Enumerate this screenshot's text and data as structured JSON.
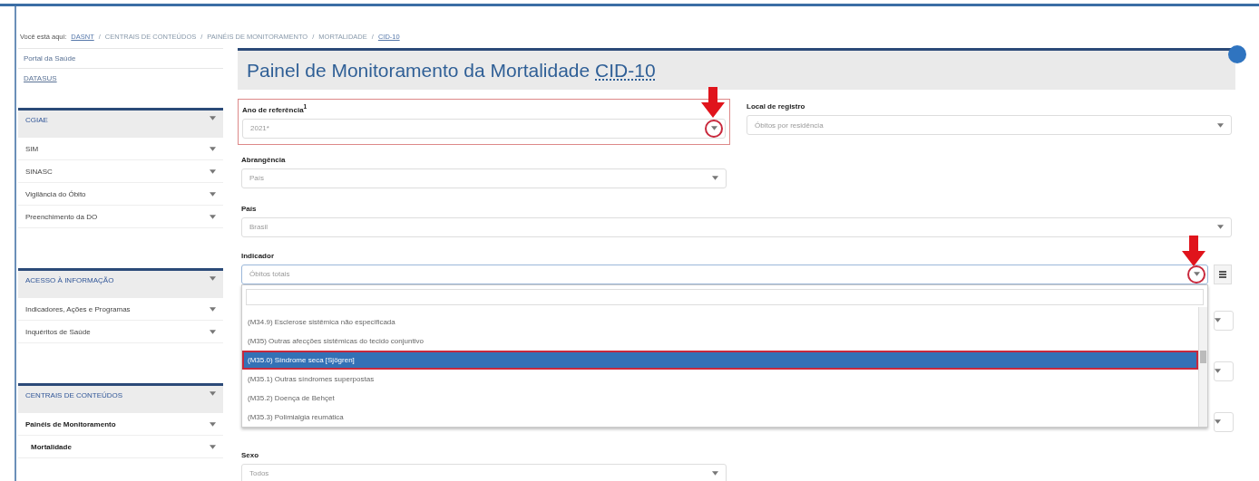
{
  "breadcrumb": {
    "label": "Você está aqui:",
    "items": [
      {
        "text": "DASNT",
        "link": true
      },
      {
        "text": "CENTRAIS DE CONTEÚDOS",
        "link": false
      },
      {
        "text": "PAINÉIS DE MONITORAMENTO",
        "link": false
      },
      {
        "text": "MORTALIDADE",
        "link": false
      },
      {
        "text": "CID-10",
        "link": true
      }
    ],
    "separator": "/"
  },
  "sidebar": {
    "links": [
      {
        "text": "Portal da Saúde",
        "link": false
      },
      {
        "text": "DATASUS",
        "link": true
      }
    ],
    "panels": [
      {
        "title": "CGIAE",
        "items": [
          {
            "text": "SIM",
            "active": false
          },
          {
            "text": "SINASC",
            "active": false
          },
          {
            "text": "Vigilância do Óbito",
            "active": false
          },
          {
            "text": "Preenchimento da DO",
            "active": false
          }
        ]
      },
      {
        "title": "ACESSO À INFORMAÇÃO",
        "items": [
          {
            "text": "Indicadores, Ações e Programas",
            "active": false
          },
          {
            "text": "Inquéritos de Saúde",
            "active": false
          }
        ]
      },
      {
        "title": "CENTRAIS DE CONTEÚDOS",
        "items": [
          {
            "text": "Painéis de Monitoramento",
            "active": true,
            "children": [
              {
                "text": "Mortalidade",
                "active": true
              }
            ]
          }
        ]
      }
    ]
  },
  "page": {
    "title": "Painel de Monitoramento da Mortalidade",
    "abbr": "CID-10"
  },
  "fields": [
    {
      "label": "Ano de referência$^{1}$",
      "value": "2021*",
      "highlighted": true,
      "callout": true,
      "expanded": false
    },
    {
      "label": "Local de registro",
      "value": "Óbitos por residência",
      "highlighted": false,
      "callout": false,
      "expanded": false
    },
    {
      "label": "Abrangência",
      "value": "País",
      "highlighted": false,
      "callout": false,
      "expanded": false
    },
    {
      "label": "País",
      "value": "Brasil",
      "highlighted": false,
      "callout": false,
      "expanded": false
    },
    {
      "label": "Indicador",
      "value": "Óbitos totais",
      "highlighted": false,
      "callout": true,
      "expanded": true,
      "list_button": true,
      "options": [
        {
          "text": "(M34.9) Esclerose sistêmica não especificada",
          "selected": false
        },
        {
          "text": "(M35) Outras afecções sistêmicas do tecido conjuntivo",
          "selected": false
        },
        {
          "text": "(M35.0) Síndrome seca [Sjögren]",
          "selected": true
        },
        {
          "text": "(M35.1) Outras síndromes superpostas",
          "selected": false
        },
        {
          "text": "(M35.2) Doença de Behçet",
          "selected": false
        },
        {
          "text": "(M35.3) Polimialgia reumática",
          "selected": false
        }
      ]
    },
    {
      "kind": "covered"
    },
    {
      "kind": "covered"
    },
    {
      "kind": "covered"
    },
    {
      "label": "Sexo",
      "value": "Todos",
      "highlighted": false,
      "callout": false,
      "expanded": false
    }
  ]
}
